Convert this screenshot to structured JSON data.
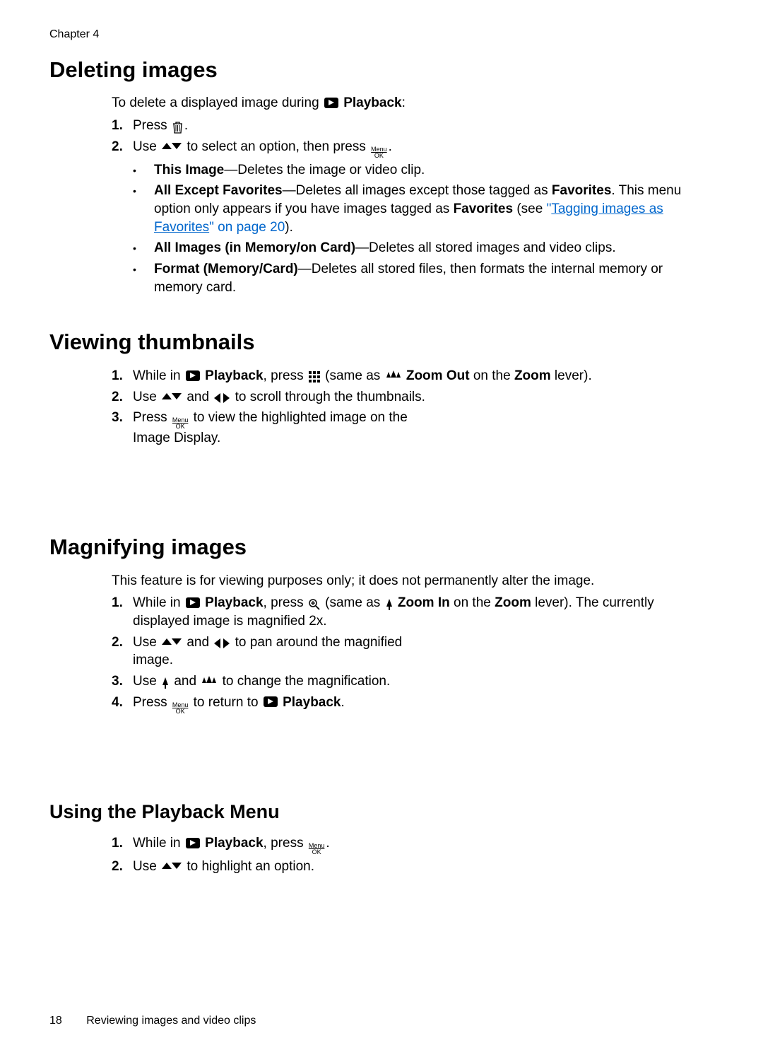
{
  "chapter_label": "Chapter 4",
  "sections": {
    "deleting": {
      "heading": "Deleting images",
      "intro_1": "To delete a displayed image during ",
      "intro_bold": "Playback",
      "intro_3": ":",
      "step1_a": "Press ",
      "step1_b": ".",
      "step2_a": "Use ",
      "step2_b": " to select an option, then press ",
      "step2_c": ".",
      "b1_bold": "This Image",
      "b1_rest": "—Deletes the image or video clip.",
      "b2_bold": "All Except Favorites",
      "b2_mid": "—Deletes all images except those tagged as ",
      "b2_fav": "Favorites",
      "b2_end": ". This menu option only appears if you have images tagged as ",
      "b2_fav2": "Favorites",
      "b2_see": " (see ",
      "b2_link_q": "\"",
      "b2_link_text": "Tagging images as Favorites",
      "b2_link_after": "\" on page 20",
      "b2_close": ").",
      "b3_bold": "All Images (in Memory/on Card)",
      "b3_rest": "—Deletes all stored images and video clips.",
      "b4_bold": "Format (Memory/Card)",
      "b4_rest": "—Deletes all stored files, then formats the internal memory or memory card."
    },
    "thumbnails": {
      "heading": "Viewing thumbnails",
      "s1_a": "While in ",
      "s1_play": "Playback",
      "s1_b": ", press ",
      "s1_c": " (same as ",
      "s1_zoomout": "Zoom Out",
      "s1_d": " on the ",
      "s1_zoom": "Zoom",
      "s1_e": " lever).",
      "s2_a": "Use ",
      "s2_b": " and ",
      "s2_c": " to scroll through the thumbnails.",
      "s3_a": "Press ",
      "s3_b": " to view the highlighted image on the Image Display."
    },
    "magnify": {
      "heading": "Magnifying images",
      "intro": "This feature is for viewing purposes only; it does not permanently alter the image.",
      "s1_a": "While in ",
      "s1_play": "Playback",
      "s1_b": ", press ",
      "s1_c": " (same as ",
      "s1_zoomin": "Zoom In",
      "s1_d": " on the ",
      "s1_zoom": "Zoom",
      "s1_e": " lever). The currently displayed image is magnified 2x.",
      "s2_a": "Use ",
      "s2_b": " and ",
      "s2_c": " to pan around the magnified image.",
      "s3_a": "Use ",
      "s3_b": " and ",
      "s3_c": " to change the magnification.",
      "s4_a": "Press ",
      "s4_b": " to return to ",
      "s4_play": "Playback",
      "s4_c": "."
    },
    "menu": {
      "heading": "Using the Playback Menu",
      "s1_a": "While in ",
      "s1_play": "Playback",
      "s1_b": ", press ",
      "s1_c": ".",
      "s2_a": "Use ",
      "s2_b": " to highlight an option."
    }
  },
  "footer": {
    "page_number": "18",
    "title": "Reviewing images and video clips"
  },
  "icons": {
    "menu_top": "Menu",
    "menu_bot": "OK"
  }
}
